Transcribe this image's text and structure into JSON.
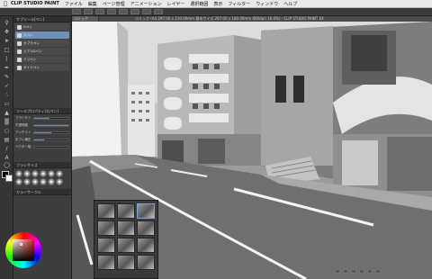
{
  "menubar": {
    "app_name": "CLIP STUDIO PAINT",
    "items": [
      "ファイル",
      "編集",
      "ページ管理",
      "アニメーション",
      "レイヤー",
      "選択範囲",
      "表示",
      "フィルター",
      "ウィンドウ",
      "ヘルプ"
    ]
  },
  "document": {
    "title_line": "コミック (A4 297.00 x 210.00mm 基本サイズ 297.00 x 180.00mm 600dpi) 16.0%] - CLIP STUDIO PAINT EX",
    "tab_label": "コミック"
  },
  "left_panel": {
    "subtool_header": "サブツール[ペン]",
    "subtools": [
      {
        "label": "Gペン",
        "selected": false
      },
      {
        "label": "丸ペン",
        "selected": true
      },
      {
        "label": "カブラペン",
        "selected": false
      },
      {
        "label": "リアルGペン",
        "selected": false
      },
      {
        "label": "ミリペン",
        "selected": false
      },
      {
        "label": "ガイドペン",
        "selected": false
      }
    ],
    "tool_property_header": "ツールプロパティ[丸ペン]",
    "properties": [
      {
        "label": "ブラシサイズ",
        "value": 0.45
      },
      {
        "label": "不透明度",
        "value": 1.0
      },
      {
        "label": "アンチエイリアス",
        "value": 0.5
      },
      {
        "label": "手ブレ補正",
        "value": 0.3
      },
      {
        "label": "ベクター吸着",
        "value": 0.0
      }
    ],
    "brush_size_header": "ブラシサイズ",
    "color_wheel_header": "カラーサークル"
  },
  "colors": {
    "primary": "#000000",
    "secondary": "#ffffff",
    "selection_accent": "#6f8fb5"
  }
}
